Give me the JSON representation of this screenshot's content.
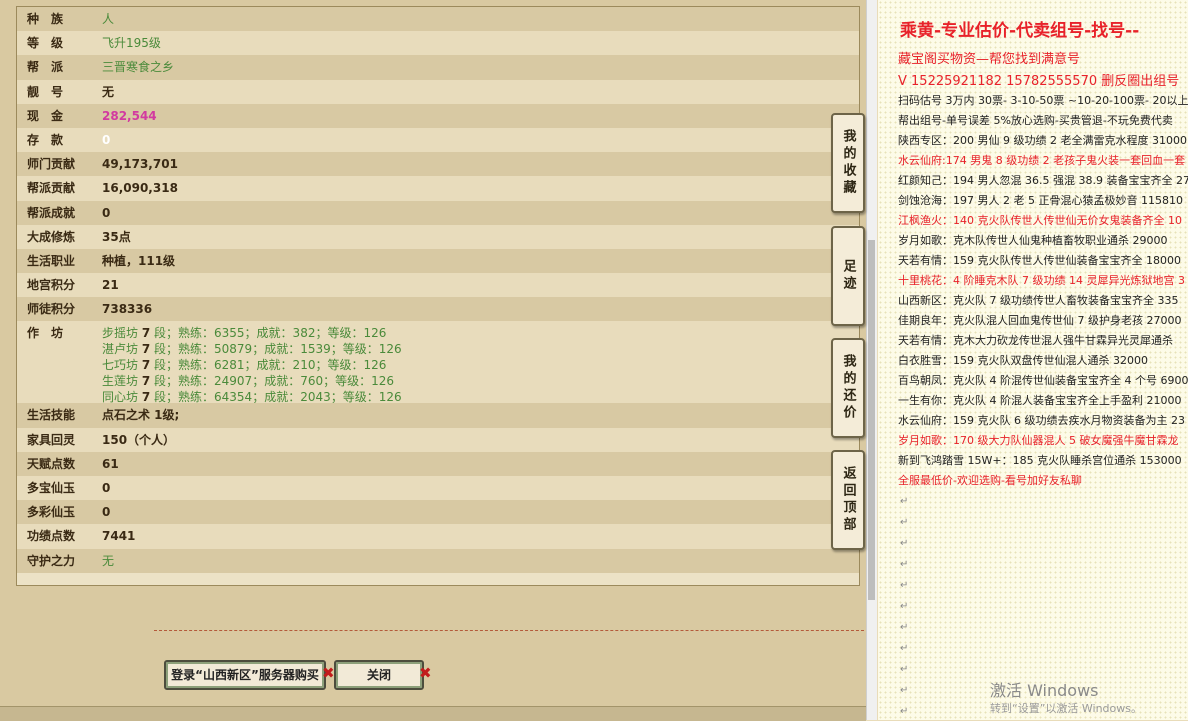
{
  "profile_rows": [
    {
      "label": "种　族",
      "value": "人",
      "style": "green"
    },
    {
      "label": "等　级",
      "value": "飞升195级",
      "style": "green"
    },
    {
      "label": "帮　派",
      "value": "三晋寒食之乡",
      "style": "green"
    },
    {
      "label": "靓　号",
      "value": "无",
      "style": "normal"
    },
    {
      "label": "现　金",
      "value": "282,544",
      "style": "pink"
    },
    {
      "label": "存　款",
      "value": "0",
      "style": "white"
    },
    {
      "label": "师门贡献",
      "value": "49,173,701",
      "style": "normal"
    },
    {
      "label": "帮派贡献",
      "value": "16,090,318",
      "style": "normal"
    },
    {
      "label": "帮派成就",
      "value": "0",
      "style": "normal"
    },
    {
      "label": "大成修炼",
      "value": "35点",
      "style": "normal"
    },
    {
      "label": "生活职业",
      "value": "种植，111级",
      "style": "normal"
    },
    {
      "label": "地宫积分",
      "value": "21",
      "style": "normal"
    },
    {
      "label": "师徒积分",
      "value": "738336",
      "style": "normal"
    }
  ],
  "workshop": {
    "label": "作　坊",
    "lines": [
      {
        "name": "步摇坊",
        "n": "7",
        "text": " 段；熟练：6355；成就：382；等级：126"
      },
      {
        "name": "湛卢坊",
        "n": "7",
        "text": " 段；熟练：50879；成就：1539；等级：126"
      },
      {
        "name": "七巧坊",
        "n": "7",
        "text": " 段；熟练：6281；成就：210；等级：126"
      },
      {
        "name": "生莲坊",
        "n": "7",
        "text": " 段；熟练：24907；成就：760；等级：126"
      },
      {
        "name": "同心坊",
        "n": "7",
        "text": " 段；熟练：64354；成就：2043；等级：126"
      }
    ]
  },
  "profile_rows2": [
    {
      "label": "生活技能",
      "value": "点石之术 1级;",
      "style": "normal"
    },
    {
      "label": "家具回灵",
      "value": "150（个人）",
      "style": "normal"
    },
    {
      "label": "天赋点数",
      "value": "61",
      "style": "normal"
    },
    {
      "label": "多宝仙玉",
      "value": "0",
      "style": "normal"
    },
    {
      "label": "多彩仙玉",
      "value": "0",
      "style": "normal"
    },
    {
      "label": "功绩点数",
      "value": "7441",
      "style": "normal"
    },
    {
      "label": "守护之力",
      "value": "无",
      "style": "green"
    }
  ],
  "side_buttons": [
    "我的收藏",
    "足迹",
    "我的还价",
    "返回顶部"
  ],
  "buttons": {
    "login": "登录“山西新区”服务器购买",
    "close": "关闭"
  },
  "doc": {
    "title": "乘黄-专业估价-代卖组号-找号--",
    "lines": [
      {
        "text": "藏宝阁买物资—帮您找到满意号",
        "style": "red big"
      },
      {
        "text": "V 15225921182 15782555570 删反圈出组号",
        "style": "red big"
      },
      {
        "text": "扫码估号 3万内 30票- 3-10-50票 ~10-20-100票- 20以上",
        "style": "normal"
      },
      {
        "text": "帮出组号-单号误差 5%放心选购-买贵管退-不玩免费代卖",
        "style": "normal"
      },
      {
        "text": "陕西专区：200 男仙 9 级功绩 2 老全满雷克水程度 31000",
        "style": "normal"
      },
      {
        "text": "水云仙府:174 男鬼 8 级功绩 2 老孩子鬼火装一套回血一套",
        "style": "red"
      },
      {
        "text": "红颜知己：194 男人忽混 36.5 强混 38.9 装备宝宝齐全 270",
        "style": "normal"
      },
      {
        "text": "剑蚀沧海：197 男人 2 老 5 正骨混心猿孟极妙音 115810",
        "style": "normal"
      },
      {
        "text": "江枫渔火：140 克火队传世人传世仙无价女鬼装备齐全 10",
        "style": "red"
      },
      {
        "text": "岁月如歌：克木队传世人仙鬼种植畜牧职业通杀 29000",
        "style": "normal"
      },
      {
        "text": "天若有情：159 克火队传世人传世仙装备宝宝齐全 18000",
        "style": "normal"
      },
      {
        "text": "十里桃花：4 阶睡克木队 7 级功绩 14 灵犀异光炼狱地宫 3",
        "style": "red"
      },
      {
        "text": "山西新区：克火队 7 级功绩传世人畜牧装备宝宝齐全 335",
        "style": "normal"
      },
      {
        "text": "佳期良年：克火队混人回血鬼传世仙 7 级护身老孩 27000",
        "style": "normal"
      },
      {
        "text": "天若有情：克木大力砍龙传世混人强牛甘霖异光灵犀通杀",
        "style": "normal"
      },
      {
        "text": "白衣胜雪：159 克火队双盘传世仙混人通杀 32000",
        "style": "normal"
      },
      {
        "text": "百鸟朝凤：克火队 4 阶混传世仙装备宝宝齐全 4 个号 6900",
        "style": "normal"
      },
      {
        "text": "一生有你：克火队 4 阶混人装备宝宝齐全上手盈利 21000",
        "style": "normal"
      },
      {
        "text": "水云仙府：159 克火队 6 级功绩去疾水月物资装备为主 23",
        "style": "normal"
      },
      {
        "text": "岁月如歌：170 级大力队仙器混人 5 破女魔强牛魔甘霖龙",
        "style": "red"
      },
      {
        "text": "新到飞鸿踏雪 15W+：185 克火队睡杀宫位通杀 153000",
        "style": "normal"
      },
      {
        "text": "全服最低价-欢迎选购-看号加好友私聊",
        "style": "red"
      }
    ],
    "para_mark": "↵"
  },
  "watermark": {
    "line1": "激活 Windows",
    "line2": "转到“设置”以激活 Windows。"
  }
}
